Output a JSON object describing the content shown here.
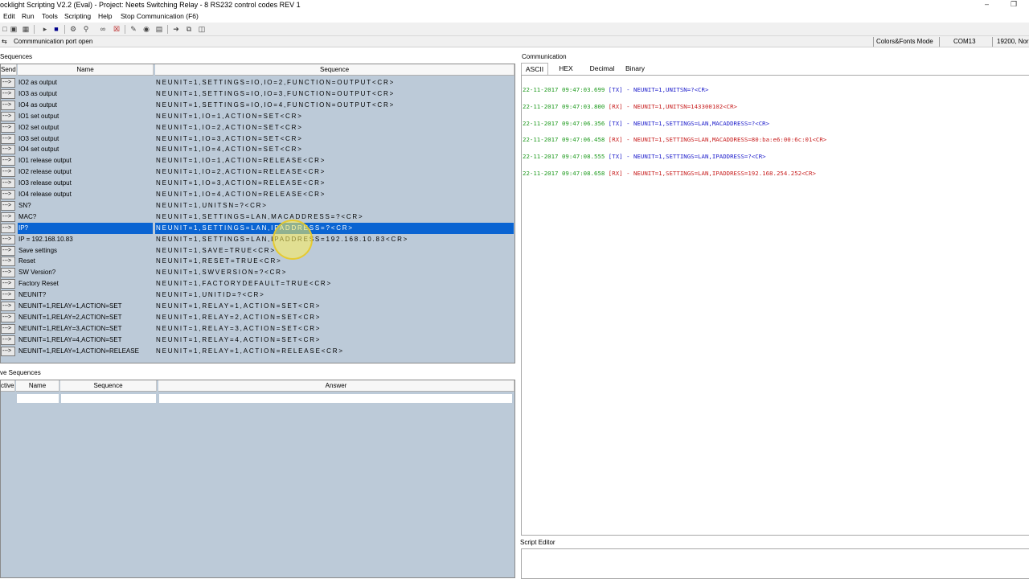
{
  "window": {
    "title": "ocklight Scripting V2.2 (Eval) - Project: Neets Switching Relay - 8 RS232 control codes REV 1",
    "minimize_glyph": "–",
    "restore_glyph": "❐"
  },
  "menu": [
    "Edit",
    "Run",
    "Tools",
    "Scripting",
    "Help",
    "Stop Communication  (F6)"
  ],
  "toolbar_icons": [
    "new-icon",
    "save-icon",
    "print-icon",
    "cut-icon",
    "play-icon",
    "stop-icon",
    "settings-icon",
    "search-icon",
    "binoculars-icon",
    "clear-icon",
    "edit-icon",
    "camera-icon",
    "printer-icon",
    "export-icon",
    "copy-icon",
    "window-icon"
  ],
  "status": {
    "port_icon": "port-icon",
    "port_text": "Commmunication port open",
    "mode": "Colors&Fonts Mode",
    "com": "COM13",
    "baud": "19200, Nor"
  },
  "sequences": {
    "section_label": "Sequences",
    "headers": {
      "send": "Send",
      "name": "Name",
      "sequence": "Sequence"
    },
    "send_label": "--->",
    "rows": [
      {
        "name": "IO2 as output",
        "sequence": "NEUNIT=1,SETTINGS=IO,IO=2,FUNCTION=OUTPUT<CR>"
      },
      {
        "name": "IO3 as output",
        "sequence": "NEUNIT=1,SETTINGS=IO,IO=3,FUNCTION=OUTPUT<CR>"
      },
      {
        "name": "IO4 as output",
        "sequence": "NEUNIT=1,SETTINGS=IO,IO=4,FUNCTION=OUTPUT<CR>"
      },
      {
        "name": "IO1 set output",
        "sequence": "NEUNIT=1,IO=1,ACTION=SET<CR>"
      },
      {
        "name": "IO2 set output",
        "sequence": "NEUNIT=1,IO=2,ACTION=SET<CR>"
      },
      {
        "name": "IO3 set output",
        "sequence": "NEUNIT=1,IO=3,ACTION=SET<CR>"
      },
      {
        "name": "IO4 set output",
        "sequence": "NEUNIT=1,IO=4,ACTION=SET<CR>"
      },
      {
        "name": "IO1 release output",
        "sequence": "NEUNIT=1,IO=1,ACTION=RELEASE<CR>"
      },
      {
        "name": "IO2 release output",
        "sequence": "NEUNIT=1,IO=2,ACTION=RELEASE<CR>"
      },
      {
        "name": "IO3 release output",
        "sequence": "NEUNIT=1,IO=3,ACTION=RELEASE<CR>"
      },
      {
        "name": "IO4 release output",
        "sequence": "NEUNIT=1,IO=4,ACTION=RELEASE<CR>"
      },
      {
        "name": "SN?",
        "sequence": "NEUNIT=1,UNITSN=?<CR>"
      },
      {
        "name": "MAC?",
        "sequence": "NEUNIT=1,SETTINGS=LAN,MACADDRESS=?<CR>"
      },
      {
        "name": "IP?",
        "sequence": "NEUNIT=1,SETTINGS=LAN,IPADDRESS=?<CR>"
      },
      {
        "name": "IP = 192.168.10.83",
        "sequence": "NEUNIT=1,SETTINGS=LAN,IPADDRESS=192.168.10.83<CR>"
      },
      {
        "name": "Save settings",
        "sequence": "NEUNIT=1,SAVE=TRUE<CR>"
      },
      {
        "name": "Reset",
        "sequence": "NEUNIT=1,RESET=TRUE<CR>"
      },
      {
        "name": "SW Version?",
        "sequence": "NEUNIT=1,SWVERSION=?<CR>"
      },
      {
        "name": "Factory Reset",
        "sequence": "NEUNIT=1,FACTORYDEFAULT=TRUE<CR>"
      },
      {
        "name": "NEUNIT?",
        "sequence": "NEUNIT=1,UNITID=?<CR>"
      },
      {
        "name": "NEUNIT=1,RELAY=1,ACTION=SET",
        "sequence": "NEUNIT=1,RELAY=1,ACTION=SET<CR>"
      },
      {
        "name": "NEUNIT=1,RELAY=2,ACTION=SET",
        "sequence": "NEUNIT=1,RELAY=2,ACTION=SET<CR>"
      },
      {
        "name": "NEUNIT=1,RELAY=3,ACTION=SET",
        "sequence": "NEUNIT=1,RELAY=3,ACTION=SET<CR>"
      },
      {
        "name": "NEUNIT=1,RELAY=4,ACTION=SET",
        "sequence": "NEUNIT=1,RELAY=4,ACTION=SET<CR>"
      },
      {
        "name": "NEUNIT=1,RELAY=1,ACTION=RELEASE",
        "sequence": "NEUNIT=1,RELAY=1,ACTION=RELEASE<CR>"
      }
    ],
    "selected_index": 13
  },
  "active_sequences": {
    "section_label": "ve Sequences",
    "headers": {
      "active": "ctive",
      "name": "Name",
      "sequence": "Sequence",
      "answer": "Answer"
    }
  },
  "communication": {
    "section_label": "Communication",
    "tabs": [
      "ASCII",
      "HEX",
      "Decimal",
      "Binary"
    ],
    "active_tab": "ASCII",
    "lines": [
      {
        "ts": "22-11-2017 09:47:03.699",
        "dir": "[TX]",
        "sep": "-",
        "msg": "NEUNIT=1,UNITSN=?<CR>"
      },
      {
        "ts": "22-11-2017 09:47:03.800",
        "dir": "[RX]",
        "sep": "-",
        "msg": "NEUNIT=1,UNITSN=143300102<CR>"
      },
      {
        "ts": "22-11-2017 09:47:06.356",
        "dir": "[TX]",
        "sep": "-",
        "msg": "NEUNIT=1,SETTINGS=LAN,MACADDRESS=?<CR>"
      },
      {
        "ts": "22-11-2017 09:47:06.458",
        "dir": "[RX]",
        "sep": "-",
        "msg": "NEUNIT=1,SETTINGS=LAN,MACADDRESS=80:ba:e6:00:6c:01<CR>"
      },
      {
        "ts": "22-11-2017 09:47:08.555",
        "dir": "[TX]",
        "sep": "-",
        "msg": "NEUNIT=1,SETTINGS=LAN,IPADDRESS=?<CR>"
      },
      {
        "ts": "22-11-2017 09:47:08.658",
        "dir": "[RX]",
        "sep": "-",
        "msg": "NEUNIT=1,SETTINGS=LAN,IPADDRESS=192.168.254.252<CR>"
      }
    ]
  },
  "script_editor": {
    "section_label": "Script Editor"
  }
}
